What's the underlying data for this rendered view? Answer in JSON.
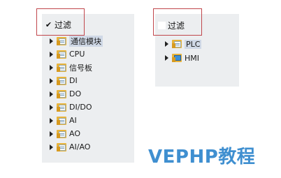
{
  "left_panel": {
    "filter": {
      "label": "过滤",
      "checked": true
    },
    "items": [
      {
        "label": "通信模块",
        "selected": true
      },
      {
        "label": "CPU"
      },
      {
        "label": "信号板"
      },
      {
        "label": "DI"
      },
      {
        "label": "DO"
      },
      {
        "label": "DI/DO"
      },
      {
        "label": "AI"
      },
      {
        "label": "AO"
      },
      {
        "label": "AI/AO"
      }
    ]
  },
  "right_panel": {
    "filter": {
      "label": "过滤",
      "checked": false
    },
    "items": [
      {
        "label": "PLC",
        "selected": true,
        "icon": "folder-icon"
      },
      {
        "label": "HMI",
        "icon": "hmi-folder-icon"
      }
    ]
  },
  "watermark": "VEPHP教程",
  "colors": {
    "panel_bg": "#eceef0",
    "highlight_border": "#c0464c",
    "selected_bg": "#cfd8e6",
    "watermark": "#3f8fd0",
    "folder": "#e9b43a"
  }
}
